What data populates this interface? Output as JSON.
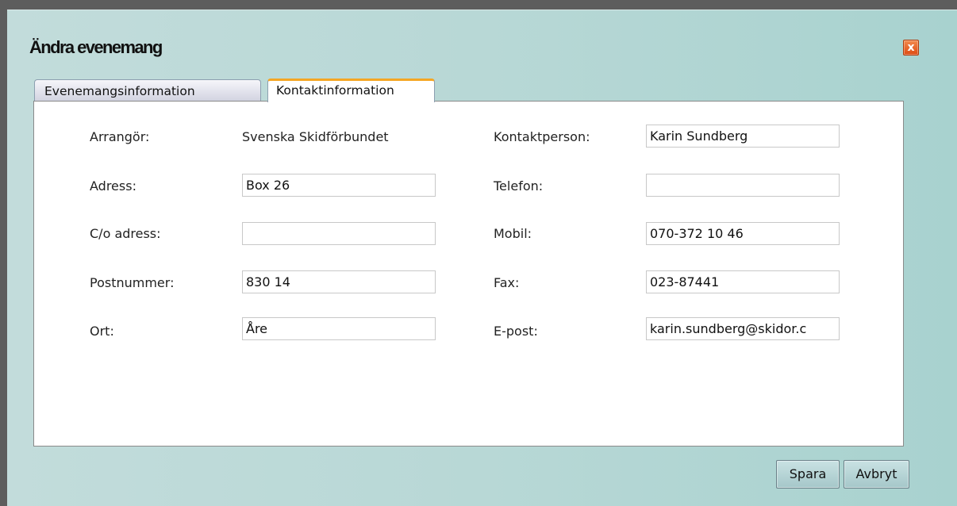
{
  "dialog": {
    "title": "Ändra evenemang",
    "close_glyph": "x"
  },
  "tabs": [
    {
      "label": "Evenemangsinformation",
      "active": false
    },
    {
      "label": "Kontaktinformation",
      "active": true
    }
  ],
  "form": {
    "left": {
      "organizer_label": "Arrangör:",
      "organizer_value": "Svenska Skidförbundet",
      "address_label": "Adress:",
      "address_value": "Box 26",
      "co_address_label": "C/o adress:",
      "co_address_value": "",
      "postal_code_label": "Postnummer:",
      "postal_code_value": "830 14",
      "city_label": "Ort:",
      "city_value": "Åre"
    },
    "right": {
      "contact_person_label": "Kontaktperson:",
      "contact_person_value": "Karin Sundberg",
      "phone_label": "Telefon:",
      "phone_value": "",
      "mobile_label": "Mobil:",
      "mobile_value": "070-372 10 46",
      "fax_label": "Fax:",
      "fax_value": "023-87441",
      "email_label": "E-post:",
      "email_value": "karin.sundberg@skidor.c"
    }
  },
  "buttons": {
    "save": "Spara",
    "cancel": "Avbryt"
  },
  "colors": {
    "accent_tab": "#f5a623",
    "close_button": "#e35a1c",
    "dialog_bg": "#b8d8d6"
  },
  "icons": {
    "close": "close-icon"
  }
}
